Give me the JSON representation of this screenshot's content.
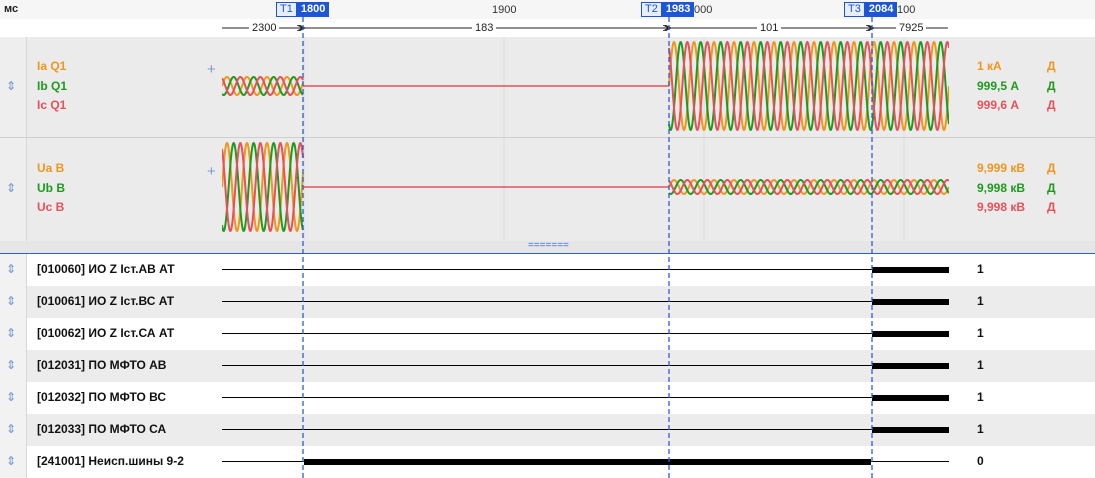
{
  "timeline": {
    "unit": "мс",
    "ticks": [
      {
        "label": "1900"
      },
      {
        "label": "000"
      },
      {
        "label": "100"
      }
    ],
    "cursors": [
      {
        "name": "T1",
        "value": "1800"
      },
      {
        "name": "T2",
        "value": "1983"
      },
      {
        "name": "T3",
        "value": "2084"
      }
    ],
    "intervals": [
      "2300",
      "183",
      "101",
      "7925"
    ]
  },
  "analog_panels": [
    {
      "channels": [
        {
          "name": "Ia Q1",
          "value": "1 кА",
          "flag": "Д",
          "color": "#f0961e"
        },
        {
          "name": "Ib Q1",
          "value": "999,5 А",
          "flag": "Д",
          "color": "#1e9a1e"
        },
        {
          "name": "Ic Q1",
          "value": "999,6 А",
          "flag": "Д",
          "color": "#e8505a"
        }
      ]
    },
    {
      "channels": [
        {
          "name": "Ua B",
          "value": "9,999 кВ",
          "flag": "Д",
          "color": "#f0961e"
        },
        {
          "name": "Ub B",
          "value": "9,998 кВ",
          "flag": "Д",
          "color": "#1e9a1e"
        },
        {
          "name": "Uc B",
          "value": "9,998 кВ",
          "flag": "Д",
          "color": "#e8505a"
        }
      ]
    }
  ],
  "splitter_label": "=======",
  "digital_rows": [
    {
      "label": "[010060] ИО Z Iст.АВ АТ",
      "value": "1"
    },
    {
      "label": "[010061] ИО Z Iст.ВС АТ",
      "value": "1"
    },
    {
      "label": "[010062] ИО Z Iст.СА АТ",
      "value": "1"
    },
    {
      "label": "[012031] ПО МФТО АВ",
      "value": "1"
    },
    {
      "label": "[012032] ПО МФТО ВС",
      "value": "1"
    },
    {
      "label": "[012033] ПО МФТО СА",
      "value": "1"
    },
    {
      "label": "[241001] Неисп.шины 9-2",
      "value": "0"
    }
  ],
  "icons": {
    "row_handle": "expand-collapse-icon",
    "add": "plus-icon"
  }
}
